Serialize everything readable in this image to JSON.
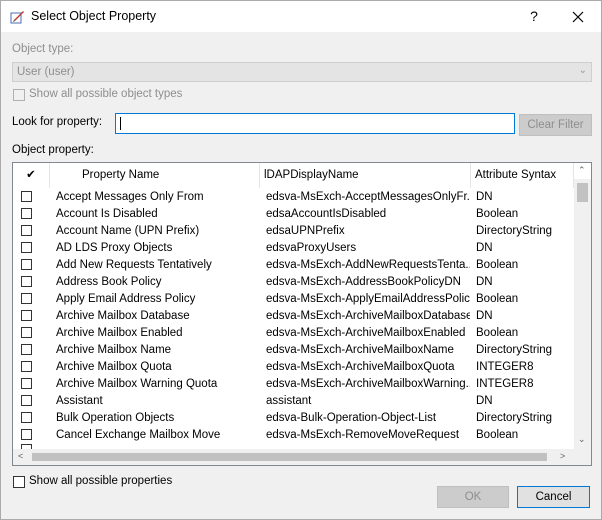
{
  "window": {
    "title": "Select Object Property",
    "help_label": "?",
    "close_label": "✕"
  },
  "object_type": {
    "label": "Object type:",
    "value": "User (user)",
    "show_all_label": "Show all possible object types"
  },
  "filter": {
    "label": "Look for property:",
    "value": "",
    "clear_label": "Clear Filter"
  },
  "list": {
    "label": "Object property:",
    "header_check": "✔",
    "columns": [
      "Property Name",
      "lDAPDisplayName",
      "Attribute Syntax"
    ],
    "rows": [
      [
        "Accept Messages Only From",
        "edsva-MsExch-AcceptMessagesOnlyFr...",
        "DN"
      ],
      [
        "Account Is Disabled",
        "edsaAccountIsDisabled",
        "Boolean"
      ],
      [
        "Account Name (UPN Prefix)",
        "edsaUPNPrefix",
        "DirectoryString"
      ],
      [
        "AD LDS Proxy Objects",
        "edsvaProxyUsers",
        "DN"
      ],
      [
        "Add New Requests Tentatively",
        "edsva-MsExch-AddNewRequestsTenta...",
        "Boolean"
      ],
      [
        "Address Book Policy",
        "edsva-MsExch-AddressBookPolicyDN",
        "DN"
      ],
      [
        "Apply Email Address Policy",
        "edsva-MsExch-ApplyEmailAddressPolicy",
        "Boolean"
      ],
      [
        "Archive Mailbox Database",
        "edsva-MsExch-ArchiveMailboxDatabase",
        "DN"
      ],
      [
        "Archive Mailbox Enabled",
        "edsva-MsExch-ArchiveMailboxEnabled",
        "Boolean"
      ],
      [
        "Archive Mailbox Name",
        "edsva-MsExch-ArchiveMailboxName",
        "DirectoryString"
      ],
      [
        "Archive Mailbox Quota",
        "edsva-MsExch-ArchiveMailboxQuota",
        "INTEGER8"
      ],
      [
        "Archive Mailbox Warning Quota",
        "edsva-MsExch-ArchiveMailboxWarning...",
        "INTEGER8"
      ],
      [
        "Assistant",
        "assistant",
        "DN"
      ],
      [
        "Bulk Operation Objects",
        "edsva-Bulk-Operation-Object-List",
        "DirectoryString"
      ],
      [
        "Cancel Exchange Mailbox Move",
        "edsva-MsExch-RemoveMoveRequest",
        "Boolean"
      ]
    ]
  },
  "footer": {
    "show_all_label": "Show all possible properties",
    "ok_label": "OK",
    "cancel_label": "Cancel"
  }
}
